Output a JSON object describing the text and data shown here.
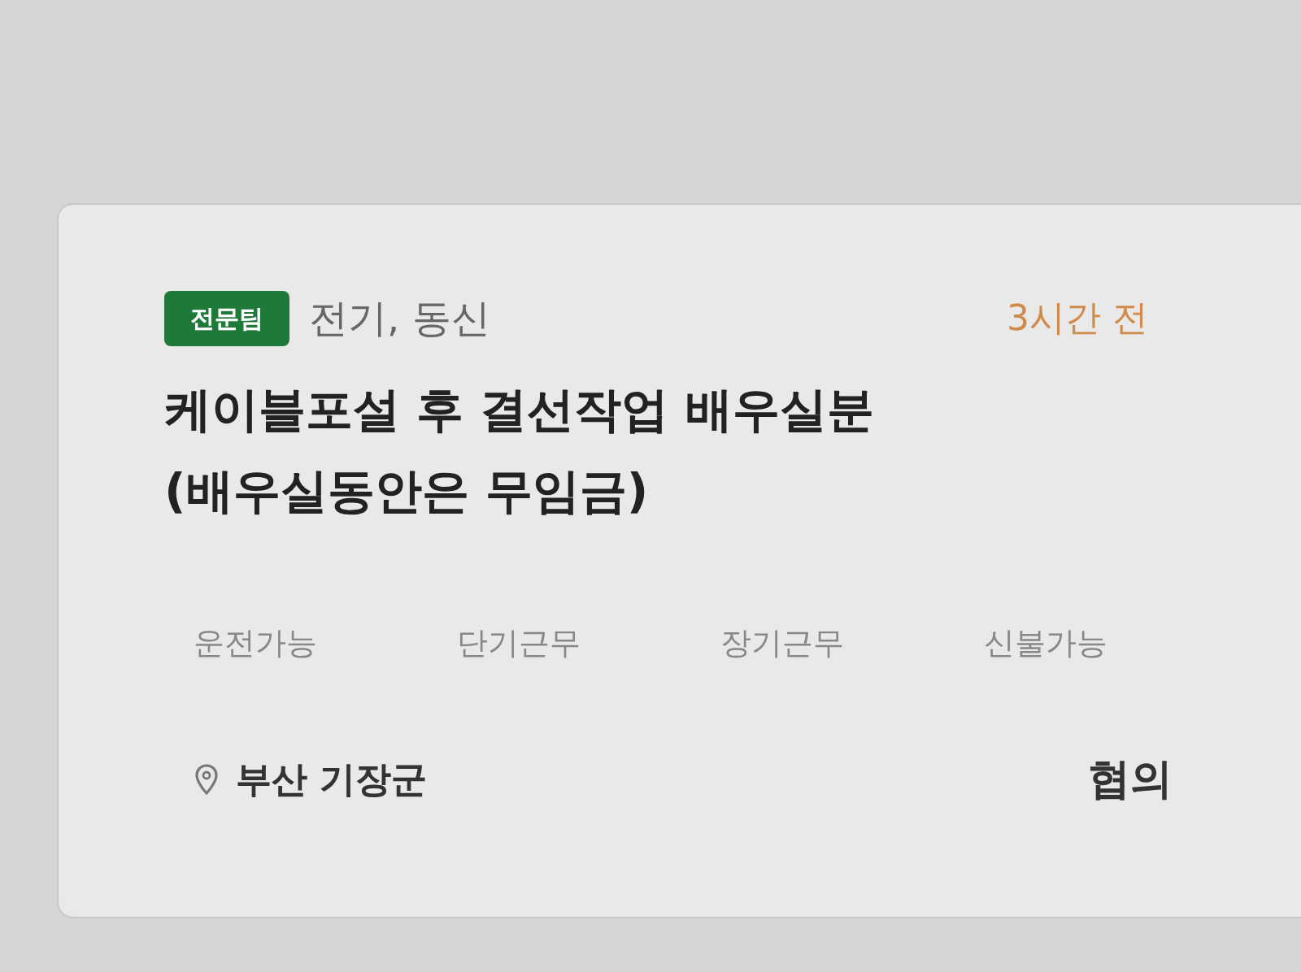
{
  "job": {
    "badge": "전문팀",
    "category": "전기, 동신",
    "posted": "3시간 전",
    "title_lines": [
      "케이블포설 후 결선작업 배우실분",
      "(배우실동안은 무임금)"
    ],
    "tags": [
      "운전가능",
      "단기근무",
      "장기근무",
      "신불가능"
    ],
    "location": "부산 기장군",
    "pay": "협의"
  }
}
